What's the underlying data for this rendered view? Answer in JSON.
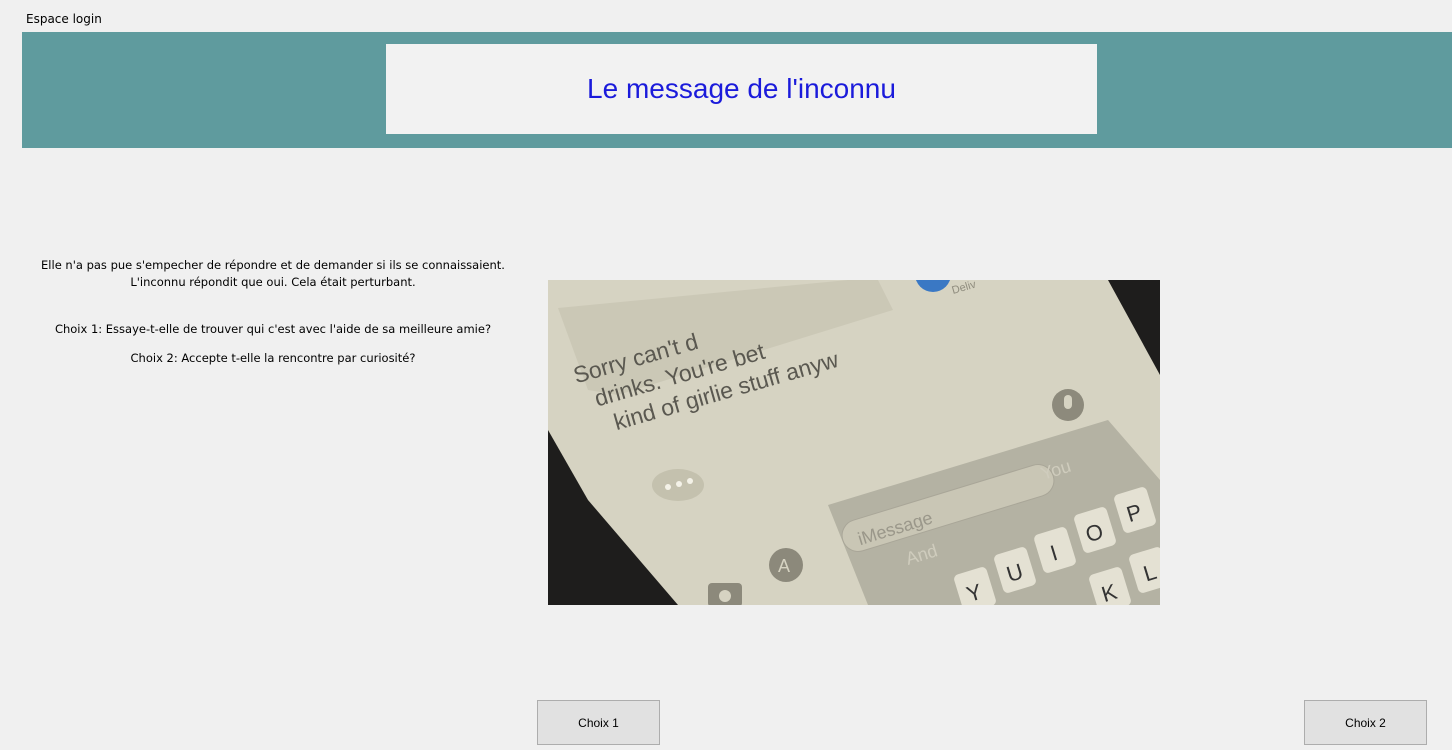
{
  "window": {
    "title": "Espace login"
  },
  "header": {
    "title": "Le message de l'inconnu",
    "band_color": "#5f9b9e",
    "title_color": "#1b1bdb"
  },
  "story": {
    "line1": "Elle n'a pas pue s'empecher de répondre et de demander si ils se connaissaient.",
    "line2": "L'inconnu répondit que oui. Cela était perturbant.",
    "choice1": "Choix 1: Essaye-t-elle de trouver qui c'est avec l'aide de sa meilleure amie?",
    "choice2": "Choix 2: Accepte t-elle la rencontre par curiosité?"
  },
  "photo": {
    "message_lines": [
      "Sorry can't d",
      "drinks. You're bet",
      "kind of girlie stuff anyw"
    ],
    "delivered": "Deliv",
    "input_placeholder": "iMessage",
    "suggestions": [
      "And",
      "You"
    ],
    "keys_row1": [
      "Y",
      "U",
      "I",
      "O",
      "P"
    ],
    "keys_row2": [
      "K",
      "L"
    ]
  },
  "buttons": {
    "choice1_label": "Choix 1",
    "choice2_label": "Choix 2"
  }
}
